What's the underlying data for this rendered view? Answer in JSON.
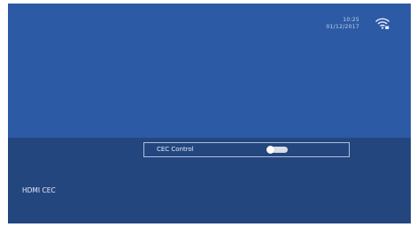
{
  "status": {
    "time": "10:25",
    "date": "01/12/2017",
    "wifi_icon": "wifi-icon"
  },
  "settings": {
    "category_label": "HDMI CEC",
    "cec_control": {
      "label": "CEC Control",
      "state": "off"
    }
  },
  "colors": {
    "background": "#2c5aa5",
    "panel": "#24467f"
  }
}
